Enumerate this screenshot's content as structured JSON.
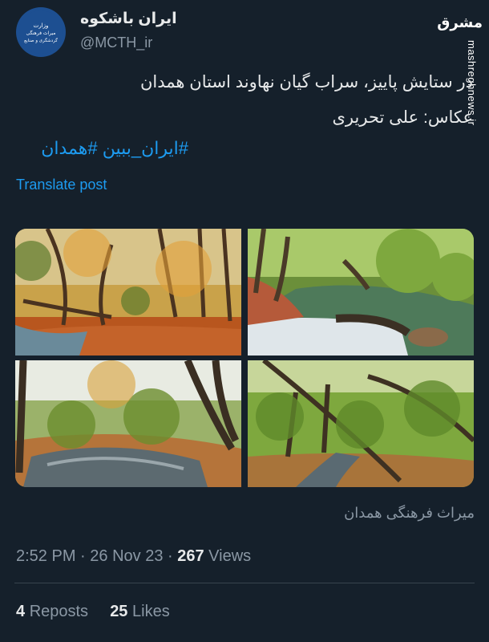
{
  "author": {
    "name": "ایران باشکوه",
    "handle": "@MCTH_ir",
    "avatar_text": "وزارت میراث فرهنگی، گردشگری و صنایع دستی"
  },
  "watermark": {
    "logo": "مشرق",
    "site": "mashreghnews.ir"
  },
  "tweet": {
    "line1": "در ستایش پاییز، سراب گیان نهاوند استان همدان",
    "line2": "عکاس: علی تحریری",
    "hashtags": "#ایران_ببین #همدان",
    "translate": "Translate post"
  },
  "photos": [
    {
      "scene": "autumn-forest-leaves"
    },
    {
      "scene": "stream-waterfall"
    },
    {
      "scene": "forest-stream"
    },
    {
      "scene": "green-forest-path"
    }
  ],
  "caption": "میراث فرهنگی همدان",
  "meta": {
    "time": "2:52 PM",
    "date": "26 Nov 23",
    "views_count": "267",
    "views_label": "Views"
  },
  "stats": {
    "reposts_count": "4",
    "reposts_label": "Reposts",
    "likes_count": "25",
    "likes_label": "Likes"
  },
  "colors": {
    "background": "#15202b",
    "accent": "#1d9bf0",
    "muted": "#8b98a5"
  }
}
